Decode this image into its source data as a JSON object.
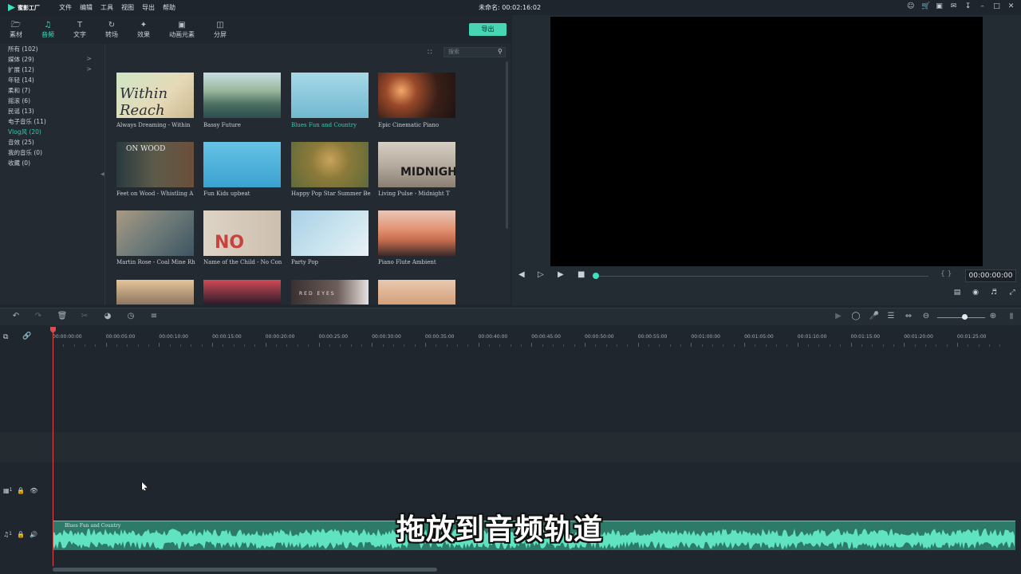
{
  "app": {
    "logo_text": "蜜影工厂",
    "doc_title": "未命名: 00:02:16:02"
  },
  "menu": [
    "文件",
    "编辑",
    "工具",
    "视图",
    "导出",
    "帮助"
  ],
  "tabs": [
    {
      "label": "素材",
      "icon": "folder-icon"
    },
    {
      "label": "音频",
      "icon": "music-note-icon",
      "active": true
    },
    {
      "label": "文字",
      "icon": "text-icon"
    },
    {
      "label": "转场",
      "icon": "transition-icon"
    },
    {
      "label": "效果",
      "icon": "effects-icon"
    },
    {
      "label": "动画元素",
      "icon": "image-icon"
    },
    {
      "label": "分屏",
      "icon": "split-screen-icon"
    }
  ],
  "export_label": "导出",
  "categories": [
    {
      "label": "所有 (102)"
    },
    {
      "label": "媒体 (29)",
      "expand": ">"
    },
    {
      "label": "扩展 (12)",
      "expand": ">"
    },
    {
      "label": "年轻 (14)"
    },
    {
      "label": "柔和 (7)"
    },
    {
      "label": "摇滚 (6)"
    },
    {
      "label": "民谣 (13)"
    },
    {
      "label": "电子音乐 (11)"
    },
    {
      "label": "Vlog风 (20)",
      "active": true
    },
    {
      "label": "音效 (25)"
    },
    {
      "label": "我的音乐 (0)"
    },
    {
      "label": "收藏 (0)"
    }
  ],
  "search_placeholder": "搜索",
  "library": [
    {
      "title": "Always Dreaming - Within",
      "thumb_text": "Within Reach"
    },
    {
      "title": "Bassy Future"
    },
    {
      "title": "Blues Fun and Country",
      "active": true
    },
    {
      "title": "Epic Cinematic Piano"
    },
    {
      "title": "Feet on Wood - Whistling A",
      "thumb_text": "ON WOOD"
    },
    {
      "title": "Fun Kids upbeat"
    },
    {
      "title": "Happy Pop Star Summer Beat"
    },
    {
      "title": "Living Pulse - Midnight T",
      "thumb_text": "MIDNIGHT"
    },
    {
      "title": "Martin Rose - Coal Mine Rh"
    },
    {
      "title": "Name of the Child - No Con",
      "thumb_text": "NO"
    },
    {
      "title": "Party Pop"
    },
    {
      "title": "Piano Flute Ambient"
    },
    {
      "title": ""
    },
    {
      "title": ""
    },
    {
      "title": "",
      "thumb_text": "RED EYES"
    },
    {
      "title": ""
    }
  ],
  "preview": {
    "timecode": "00:00:00:00",
    "braces": "{ }",
    "progress": 0.0
  },
  "ruler_ticks": [
    "00:00:00:00",
    "00:00:05:00",
    "00:00:10:00",
    "00:00:15:00",
    "00:00:20:00",
    "00:00:25:00",
    "00:00:30:00",
    "00:00:35:00",
    "00:00:40:00",
    "00:00:45:00",
    "00:00:50:00",
    "00:00:55:00",
    "00:01:00:00",
    "00:01:05:00",
    "00:01:10:00",
    "00:01:15:00",
    "00:01:20:00",
    "00:01:25:00"
  ],
  "tracks": {
    "video_track_num": "1",
    "audio_track_num": "1"
  },
  "audio_clip_label": "Blues Fun and Country",
  "subtitle": "拖放到音频轨道",
  "colors": {
    "accent": "#3fe0c0",
    "clip": "#2d7a68",
    "playhead": "#e04a4a"
  }
}
